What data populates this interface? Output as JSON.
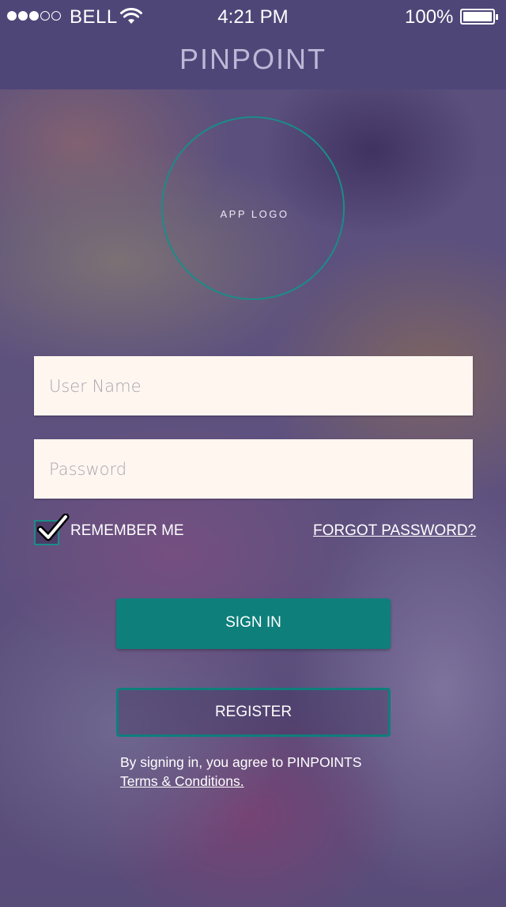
{
  "status_bar": {
    "carrier": "BELL",
    "time": "4:21 PM",
    "battery": "100%",
    "signal_bars_filled": 3,
    "signal_bars_total": 5,
    "battery_level": 1.0,
    "wifi_icon": "wifi-icon",
    "battery_icon": "battery-icon"
  },
  "header": {
    "title": "PINPOINT",
    "background": "#4f4678"
  },
  "logo": {
    "text": "APP LOGO",
    "ring_color": "#1b8c88"
  },
  "form": {
    "username_placeholder": "User Name",
    "username_value": "",
    "password_placeholder": "Password",
    "password_value": "",
    "remember_label": "REMEMBER ME",
    "remember_checked": true,
    "forgot_label": "FORGOT PASSWORD?"
  },
  "buttons": {
    "signin": "SIGN IN",
    "register": "REGISTER"
  },
  "terms": {
    "line1": "By signing in, you agree to PINPOINTS",
    "link": "Terms & Conditions."
  },
  "colors": {
    "accent": "#0e7f7b",
    "field_bg": "#fff6f0",
    "overlay": "#4e3f7a"
  }
}
